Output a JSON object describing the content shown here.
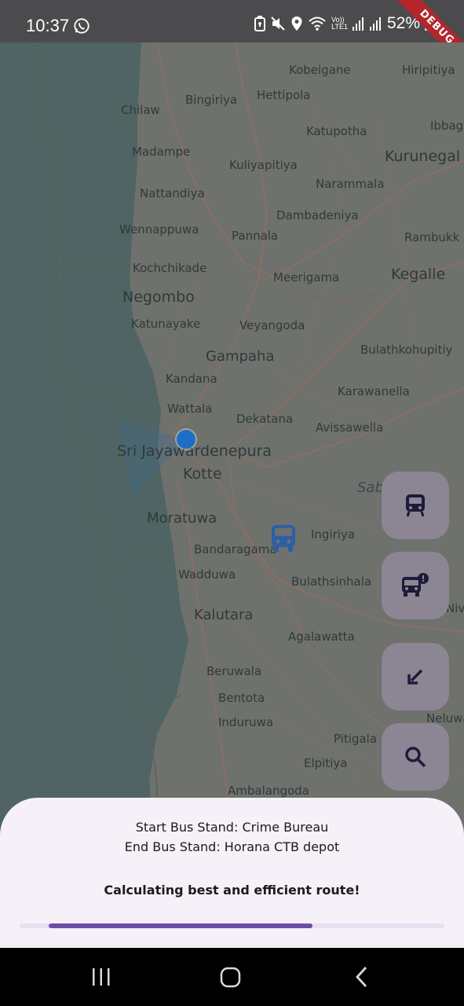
{
  "status_bar": {
    "time": "10:37",
    "battery_percent": "52%",
    "network_label_top": "Vo))",
    "network_label_bottom": "LTE1",
    "debug_banner": "DEBUG"
  },
  "map": {
    "labels": {
      "kobeigane": "Kobeigane",
      "hiripitiya": "Hiripitiya",
      "bingiriya": "Bingiriya",
      "hettipola": "Hettipola",
      "chilaw": "Chilaw",
      "ibbag": "Ibbag",
      "katupotha": "Katupotha",
      "madampe": "Madampe",
      "kurunegala": "Kurunegal",
      "kuliyapitiya": "Kuliyapitiya",
      "nattandiya": "Nattandiya",
      "narammala": "Narammala",
      "dambadeniya": "Dambadeniya",
      "wennappuwa": "Wennappuwa",
      "pannala": "Pannala",
      "rambukk": "Rambukk",
      "kochchikade": "Kochchikade",
      "meerigama": "Meerigama",
      "kegalle": "Kegalle",
      "negombo": "Negombo",
      "katunayake": "Katunayake",
      "veyangoda": "Veyangoda",
      "bulathkohupitiya": "Bulathkohupitiy",
      "gampaha": "Gampaha",
      "kandana": "Kandana",
      "karawanella": "Karawanella",
      "wattala": "Wattala",
      "dekatana": "Dekatana",
      "avissawella": "Avissawella",
      "sri_jaya_1": "Sri Jayawardenepura",
      "sri_jaya_2": "Kotte",
      "sab": "Sab",
      "moratuwa": "Moratuwa",
      "ingiriya": "Ingiriya",
      "bandaragama": "Bandaragama",
      "wadduwa": "Wadduwa",
      "bulathsinhala": "Bulathsinhala",
      "kalutara": "Kalutara",
      "agalawatta": "Agalawatta",
      "beruwala": "Beruwala",
      "bentota": "Bentota",
      "induruwa": "Induruwa",
      "neluwa": "Neluwa",
      "pitigala": "Pitigala",
      "elpitiya": "Elpitiya",
      "ambalangoda": "Ambalangoda",
      "niv": "Niv"
    },
    "icons": [
      "user-location-icon",
      "bus-marker-icon"
    ]
  },
  "fabs": [
    {
      "name": "bus-button",
      "icon": "bus-icon"
    },
    {
      "name": "bus-alert-button",
      "icon": "bus-alert-icon"
    },
    {
      "name": "arrow-button",
      "icon": "arrow-south-west-icon"
    },
    {
      "name": "search-button",
      "icon": "search-icon"
    }
  ],
  "sheet": {
    "start_text": "Start Bus Stand: Crime Bureau",
    "end_text": "End Bus Stand: Horana CTB depot",
    "calc_text": "Calculating best and efficient route!",
    "progress_fraction": 0.62
  },
  "colors": {
    "accent": "#6b4fa6",
    "fab_bg": "#8c8694",
    "sheet_bg": "#f6f0f8",
    "location_dot": "#1e6fc4"
  },
  "nav_bar": {
    "icons": [
      "recent-apps-icon",
      "home-icon",
      "back-icon"
    ]
  }
}
